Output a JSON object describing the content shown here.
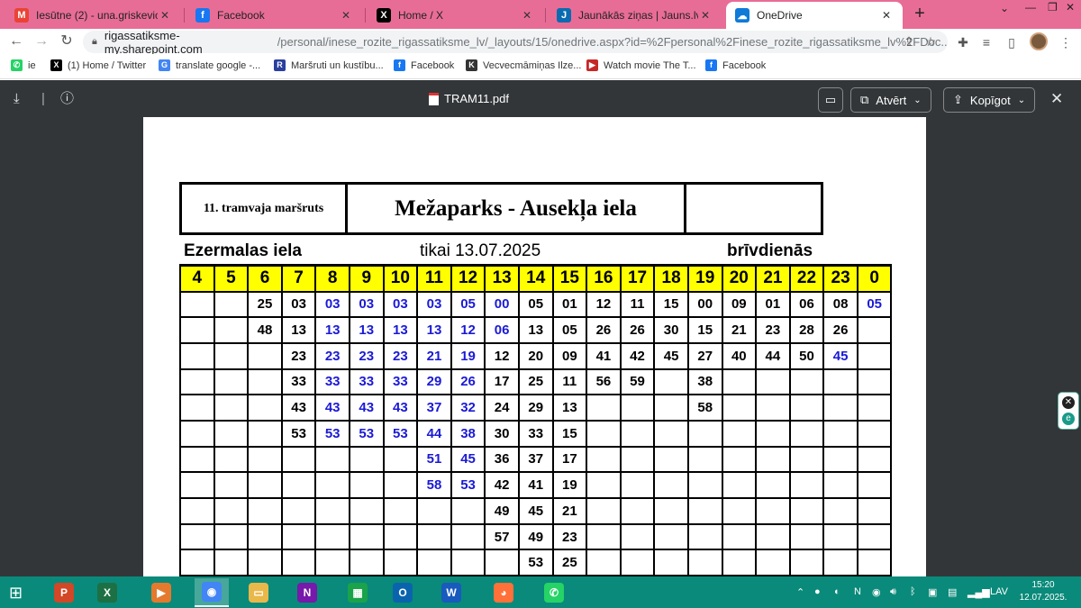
{
  "browser": {
    "tabs": [
      {
        "label": "Iesūtne (2) - una.griskevica@g",
        "icon": "gmail-icon",
        "color": "#ea4335",
        "glyph": "M"
      },
      {
        "label": "Facebook",
        "icon": "facebook-icon",
        "color": "#1877f2",
        "glyph": "f"
      },
      {
        "label": "Home / X",
        "icon": "x-icon",
        "color": "#000000",
        "glyph": "X"
      },
      {
        "label": "Jaunākās ziņas | Jauns.lv",
        "icon": "jauns-icon",
        "color": "#0b6bb0",
        "glyph": "J"
      },
      {
        "label": "OneDrive",
        "icon": "onedrive-icon",
        "color": "#0f7ad8",
        "glyph": "☁"
      }
    ],
    "new_tab": "+",
    "url_host": "rigassatiksme-my.sharepoint.com",
    "url_path": "/personal/inese_rozite_rigassatiksme_lv/_layouts/15/onedrive.aspx?id=%2Fpersonal%2Finese_rozite_rigassatiksme_lv%2FDoc...",
    "bookmarks": [
      {
        "label": "ie",
        "icon": "whatsapp-icon",
        "color": "#25d366",
        "glyph": "✆"
      },
      {
        "label": "(1) Home / Twitter",
        "icon": "x-icon",
        "color": "#000000",
        "glyph": "X"
      },
      {
        "label": "translate google -...",
        "icon": "google-icon",
        "color": "#4285f4",
        "glyph": "G"
      },
      {
        "label": "Maršruti un kustību...",
        "icon": "rigas-satiksme-icon",
        "color": "#2a3f9e",
        "glyph": "R"
      },
      {
        "label": "Facebook",
        "icon": "facebook-icon",
        "color": "#1877f2",
        "glyph": "f"
      },
      {
        "label": "Vecvecmāmiņas Ilze...",
        "icon": "bookmark-k-icon",
        "color": "#333333",
        "glyph": "K"
      },
      {
        "label": "Watch movie The T...",
        "icon": "movie-icon",
        "color": "#c62828",
        "glyph": "▶"
      },
      {
        "label": "Facebook",
        "icon": "facebook-icon",
        "color": "#1877f2",
        "glyph": "f"
      }
    ]
  },
  "viewer": {
    "file_name": "TRAM11.pdf",
    "open_label": "Atvērt",
    "copy_label": "Kopīgot"
  },
  "timetable": {
    "route_label": "11. tramvaja maršruts",
    "route_name": "Mežaparks - Ausekļa iela",
    "stop_name": "Ezermalas iela",
    "date_note": "tikai 13.07.2025",
    "day_type": "brīvdienās",
    "hours": [
      "4",
      "5",
      "6",
      "7",
      "8",
      "9",
      "10",
      "11",
      "12",
      "13",
      "14",
      "15",
      "16",
      "17",
      "18",
      "19",
      "20",
      "21",
      "22",
      "23",
      "0"
    ],
    "rows": [
      [
        "",
        "",
        "25",
        "03",
        "03",
        "03",
        "03",
        "03",
        "05",
        "00",
        "05",
        "01",
        "12",
        "11",
        "15",
        "00",
        "09",
        "01",
        "06",
        "08",
        "05"
      ],
      [
        "",
        "",
        "48",
        "13",
        "13",
        "13",
        "13",
        "13",
        "12",
        "06",
        "13",
        "05",
        "26",
        "26",
        "30",
        "15",
        "21",
        "23",
        "28",
        "26",
        ""
      ],
      [
        "",
        "",
        "",
        "23",
        "23",
        "23",
        "23",
        "21",
        "19",
        "12",
        "20",
        "09",
        "41",
        "42",
        "45",
        "27",
        "40",
        "44",
        "50",
        "45",
        ""
      ],
      [
        "",
        "",
        "",
        "33",
        "33",
        "33",
        "33",
        "29",
        "26",
        "17",
        "25",
        "11",
        "56",
        "59",
        "",
        "38",
        "",
        "",
        "",
        "",
        ""
      ],
      [
        "",
        "",
        "",
        "43",
        "43",
        "43",
        "43",
        "37",
        "32",
        "24",
        "29",
        "13",
        "",
        "",
        "",
        "58",
        "",
        "",
        "",
        "",
        ""
      ],
      [
        "",
        "",
        "",
        "53",
        "53",
        "53",
        "53",
        "44",
        "38",
        "30",
        "33",
        "15",
        "",
        "",
        "",
        "",
        "",
        "",
        "",
        "",
        ""
      ],
      [
        "",
        "",
        "",
        "",
        "",
        "",
        "",
        "51",
        "45",
        "36",
        "37",
        "17",
        "",
        "",
        "",
        "",
        "",
        "",
        "",
        "",
        ""
      ],
      [
        "",
        "",
        "",
        "",
        "",
        "",
        "",
        "58",
        "53",
        "42",
        "41",
        "19",
        "",
        "",
        "",
        "",
        "",
        "",
        "",
        "",
        ""
      ],
      [
        "",
        "",
        "",
        "",
        "",
        "",
        "",
        "",
        "",
        "49",
        "45",
        "21",
        "",
        "",
        "",
        "",
        "",
        "",
        "",
        "",
        ""
      ],
      [
        "",
        "",
        "",
        "",
        "",
        "",
        "",
        "",
        "",
        "57",
        "49",
        "23",
        "",
        "",
        "",
        "",
        "",
        "",
        "",
        "",
        ""
      ],
      [
        "",
        "",
        "",
        "",
        "",
        "",
        "",
        "",
        "",
        "",
        "53",
        "25",
        "",
        "",
        "",
        "",
        "",
        "",
        "",
        "",
        ""
      ]
    ],
    "blue_cells": {
      "0": [
        4,
        5,
        6,
        7,
        8,
        9,
        20
      ],
      "1": [
        4,
        5,
        6,
        7,
        8,
        9
      ],
      "2": [
        4,
        5,
        6,
        7,
        8,
        19
      ],
      "3": [
        4,
        5,
        6,
        7,
        8
      ],
      "4": [
        4,
        5,
        6,
        7,
        8
      ],
      "5": [
        4,
        5,
        6,
        7,
        8
      ],
      "6": [
        7,
        8
      ],
      "7": [
        7,
        8
      ]
    },
    "colors": {
      "header_bg": "#ffff00",
      "blue_text": "#1a1ad6"
    }
  },
  "taskbar": {
    "apps": [
      {
        "name": "powerpoint-app",
        "color": "#d24726",
        "glyph": "P"
      },
      {
        "name": "excel-app",
        "color": "#1d7044",
        "glyph": "X"
      },
      {
        "name": "media-player-app",
        "color": "#e47a2e",
        "glyph": "▶"
      },
      {
        "name": "chrome-app",
        "color": "#4285f4",
        "glyph": "◉"
      },
      {
        "name": "file-explorer-app",
        "color": "#e9b84a",
        "glyph": "▭"
      },
      {
        "name": "onenote-app",
        "color": "#7719aa",
        "glyph": "N"
      },
      {
        "name": "ms-store-app",
        "color": "#1aa34a",
        "glyph": "▦"
      },
      {
        "name": "outlook-app",
        "color": "#0a64ad",
        "glyph": "O"
      },
      {
        "name": "word-app",
        "color": "#185abd",
        "glyph": "W"
      },
      {
        "name": "firefox-app",
        "color": "#ff7139",
        "glyph": "◕"
      },
      {
        "name": "whatsapp-app",
        "color": "#25d366",
        "glyph": "✆"
      }
    ],
    "language": "LAV",
    "time": "15:20",
    "date": "12.07.2025."
  }
}
